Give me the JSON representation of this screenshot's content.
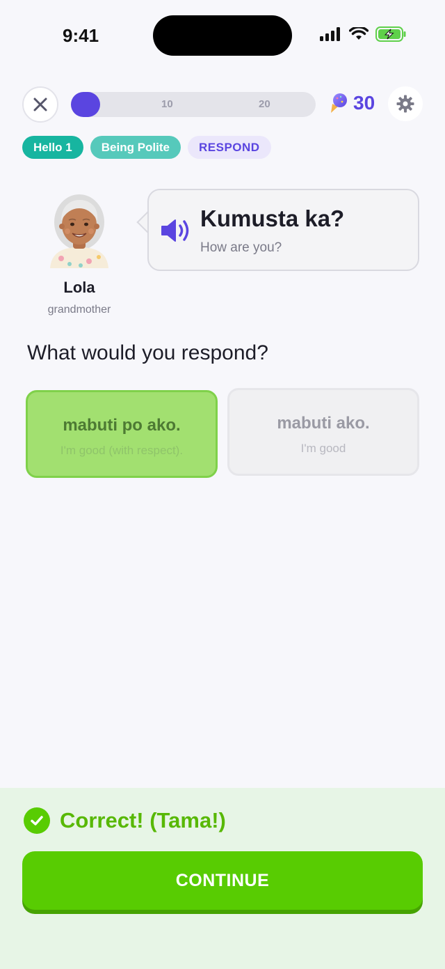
{
  "status_bar": {
    "time": "9:41",
    "icons": [
      "signal-icon",
      "wifi-icon",
      "battery-charging-icon"
    ]
  },
  "top_bar": {
    "close_icon": "close-icon",
    "progress": {
      "current": 1,
      "ticks": [
        "10",
        "20"
      ],
      "fill_fraction": 0.12
    },
    "gems": "30",
    "gem_icon": "ice-cream-icon",
    "settings_icon": "gear-icon"
  },
  "tags": {
    "level": "Hello 1",
    "topic": "Being Polite",
    "type": "RESPOND"
  },
  "character": {
    "name": "Lola",
    "role": "grandmother"
  },
  "prompt": {
    "phrase": "Kumusta ka?",
    "translation": "How are you?",
    "audio_icon": "speaker-icon"
  },
  "question": "What would you respond?",
  "options": [
    {
      "text": "mabuti po ako.",
      "translation": "I'm good (with respect).",
      "state": "correct"
    },
    {
      "text": "mabuti ako.",
      "translation": "I'm good",
      "state": "disabled"
    }
  ],
  "feedback": {
    "message": "Correct! (Tama!)",
    "button": "CONTINUE"
  },
  "colors": {
    "accent": "#5a45e0",
    "success": "#58cc02",
    "teal": "#17b5a0"
  }
}
